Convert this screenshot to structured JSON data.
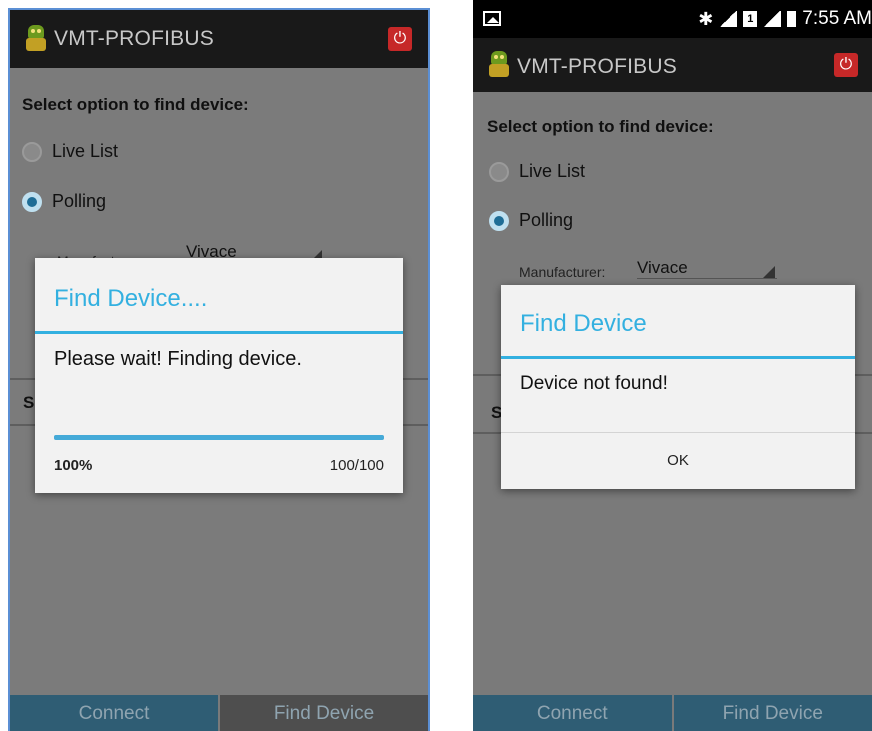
{
  "app": {
    "title": "VMT-PROFIBUS",
    "power_icon": "⏻",
    "logo_icon": "robot-logo-icon"
  },
  "status_bar": {
    "time": "7:55 AM",
    "bluetooth_icon": "✱",
    "sim_label": "1"
  },
  "screen": {
    "prompt": "Select option to find device:",
    "options": [
      {
        "label": "Live List",
        "selected": false
      },
      {
        "label": "Polling",
        "selected": true
      }
    ],
    "manufacturer_label": "Manufacturer:",
    "manufacturer_value": "Vivace",
    "partial_label": "S"
  },
  "bottom_buttons": {
    "connect": "Connect",
    "find_device": "Find Device"
  },
  "dialog_progress": {
    "title": "Find Device....",
    "message": "Please wait! Finding device.",
    "progress_fraction": 1.0,
    "percent_label": "100%",
    "count_label": "100/100"
  },
  "dialog_result": {
    "title": "Find Device",
    "message": "Device not found!",
    "ok_label": "OK"
  },
  "colors": {
    "accent": "#33b0e0",
    "app_bar": "#191919",
    "button_bar": "#2f5d74",
    "power": "#c62828"
  }
}
